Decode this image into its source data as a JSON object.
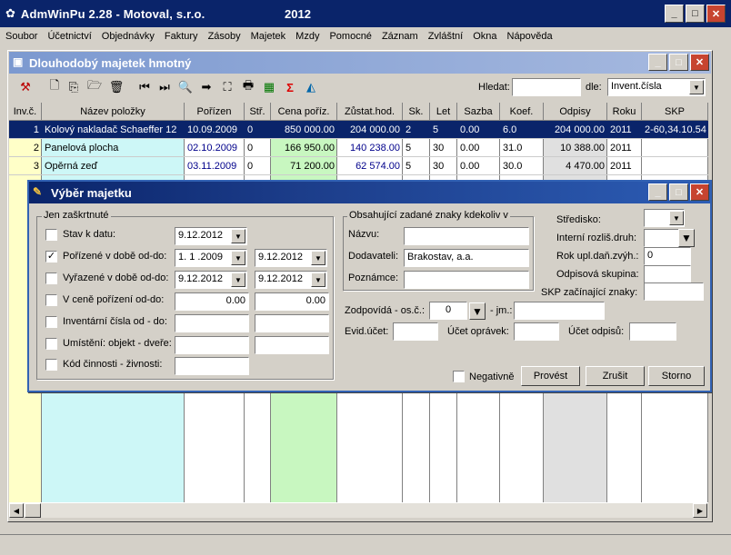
{
  "app": {
    "title": "AdmWinPu 2.28 - Motoval, s.r.o.",
    "year": "2012",
    "min": "_",
    "max": "□",
    "close": "✕"
  },
  "menu": [
    "Soubor",
    "Účetnictví",
    "Objednávky",
    "Faktury",
    "Zásoby",
    "Majetek",
    "Mzdy",
    "Pomocné",
    "Záznam",
    "Zvláštní",
    "Okna",
    "Nápověda"
  ],
  "inner": {
    "title": "Dlouhodobý majetek hmotný",
    "search_label": "Hledat:",
    "search_value": "",
    "by_label": "dle:",
    "by_value": "Invent.čísla"
  },
  "toolbar_icons": [
    "tool-icon",
    "new-icon",
    "copy-icon",
    "open-icon",
    "delete-icon",
    "first-icon",
    "last-icon",
    "search-icon",
    "next-icon",
    "select-icon",
    "print-icon",
    "export-icon",
    "sum-icon",
    "chart-icon"
  ],
  "table": {
    "columns": [
      "Inv.č.",
      "Název položky",
      "Pořízen",
      "Stř.",
      "Cena poříz.",
      "Zůstat.hod.",
      "Sk.",
      "Let",
      "Sazba",
      "Koef.",
      "Odpisy",
      "Roku",
      "SKP"
    ],
    "rows": [
      [
        "1",
        "Kolový nakladač Schaeffer 12",
        "10.09.2009",
        "0",
        "850 000.00",
        "204 000.00",
        "2",
        "5",
        "0.00",
        "6.0",
        "204 000.00",
        "2011",
        "2-60,34.10.54"
      ],
      [
        "2",
        "Panelová plocha",
        "02.10.2009",
        "0",
        "166 950.00",
        "140 238.00",
        "5",
        "30",
        "0.00",
        "31.0",
        "10 388.00",
        "2011",
        ""
      ],
      [
        "3",
        "Opěrná zeď",
        "03.11.2009",
        "0",
        "71 200.00",
        "62 574.00",
        "5",
        "30",
        "0.00",
        "30.0",
        "4 470.00",
        "2011",
        ""
      ]
    ]
  },
  "dialog": {
    "title": "Výběr majetku",
    "group1": "Jen zaškrtnuté",
    "stav": {
      "label": "Stav k datu:",
      "value": "9.12.2012"
    },
    "porizene": {
      "label": "Pořízené v době od-do:",
      "from": "1. 1 .2009",
      "to": "9.12.2012"
    },
    "vyrazene": {
      "label": "Vyřazené v době od-do:",
      "from": "9.12.2012",
      "to": "9.12.2012"
    },
    "cena": {
      "label": "V ceně pořízení od-do:",
      "from": "0.00",
      "to": "0.00"
    },
    "inv": {
      "label": "Inventární čísla od - do:"
    },
    "umisteni": {
      "label": "Umístění: objekt - dveře:"
    },
    "kod": {
      "label": "Kód činnosti - živnosti:"
    },
    "group2": "Obsahující zadané znaky kdekoliv v",
    "nazvu": "Názvu:",
    "dodavateli": "Dodavateli:",
    "dodavateli_value": "Brakostav, a.a.",
    "poznamce": "Poznámce:",
    "stredisko": "Středisko:",
    "interni": "Interní rozliš.druh:",
    "rok": "Rok upl.daň.zvýh.:",
    "rok_value": "0",
    "skupina": "Odpisová skupina:",
    "skp": "SKP začínající znaky:",
    "zodpovida": "Zodpovídá - os.č.:",
    "zodpovida_value": "0",
    "jm": "- jm.:",
    "evid": "Evid.účet:",
    "opravek": "Účet oprávek:",
    "odpisu": "Účet odpisů:",
    "negativne": "Negativně",
    "provest": "Provést",
    "zrusit": "Zrušit",
    "storno": "Storno"
  }
}
